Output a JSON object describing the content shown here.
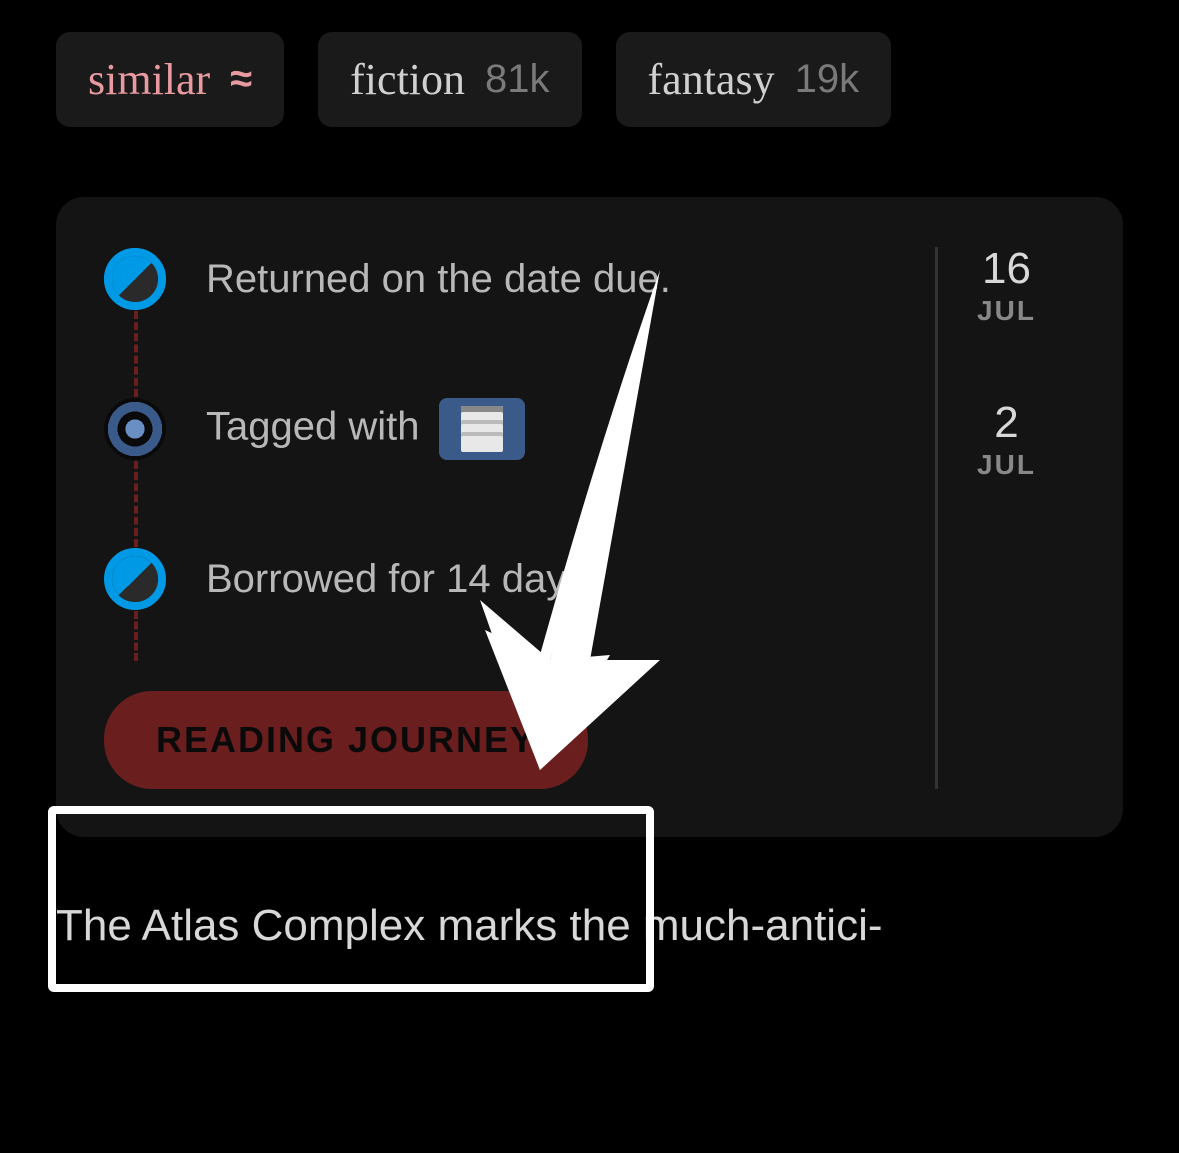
{
  "tags": [
    {
      "label": "similar",
      "count": "",
      "variant": "similar"
    },
    {
      "label": "fiction",
      "count": "81k",
      "variant": ""
    },
    {
      "label": "fantasy",
      "count": "19k",
      "variant": ""
    }
  ],
  "journey": {
    "items": [
      {
        "text": "Returned on the date due.",
        "node": "return"
      },
      {
        "text_prefix": "Tagged with ",
        "has_receipt": true,
        "node": "tagged"
      },
      {
        "text": "Borrowed for 14 days.",
        "node": "borrowed"
      }
    ],
    "dates": [
      {
        "day": "16",
        "month": "JUL"
      },
      {
        "day": "2",
        "month": "JUL"
      }
    ],
    "button_label": "READING JOURNEY"
  },
  "description": "The Atlas Complex marks the much-antici-"
}
